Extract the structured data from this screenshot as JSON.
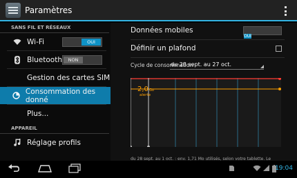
{
  "app": {
    "title": "Paramètres"
  },
  "sidebar": {
    "wireless_header": "SANS FIL ET RÉSEAUX",
    "device_header": "APPAREIL",
    "wifi": {
      "label": "Wi-Fi",
      "toggle": "OUI"
    },
    "bluetooth": {
      "label": "Bluetooth",
      "toggle": "NON"
    },
    "sim": {
      "label": "Gestion des cartes SIM"
    },
    "data_usage": {
      "label": "Consommation des donné"
    },
    "more": {
      "label": "Plus..."
    },
    "profiles": {
      "label": "Réglage profils"
    }
  },
  "detail": {
    "mobile_data": {
      "label": "Données mobiles",
      "toggle": "OUI"
    },
    "set_limit": {
      "label": "Définir un plafond",
      "checked": false
    },
    "cycle": {
      "label": "Cycle de consommation",
      "value": "du 28 sept. au 27 oct."
    },
    "warning": {
      "value": "2,0",
      "unit": "Go",
      "label": "alerte"
    },
    "footer_text": "du 28 sept. au 1 oct. : env. 1,71 Mo utilisés, selon votre tablette. Le"
  },
  "colors": {
    "accent": "#33b5e5",
    "selected": "#0e7cab",
    "limit_line": "#ff3b30",
    "warning_line": "#ffa000"
  },
  "status": {
    "time": "19:04"
  },
  "icons": [
    "settings-icon",
    "overflow-menu-icon",
    "wifi-icon",
    "bluetooth-icon",
    "data-usage-icon",
    "music-icon",
    "back-icon",
    "home-icon",
    "recent-apps-icon",
    "sim-icon",
    "signal-icon",
    "battery-icon"
  ]
}
